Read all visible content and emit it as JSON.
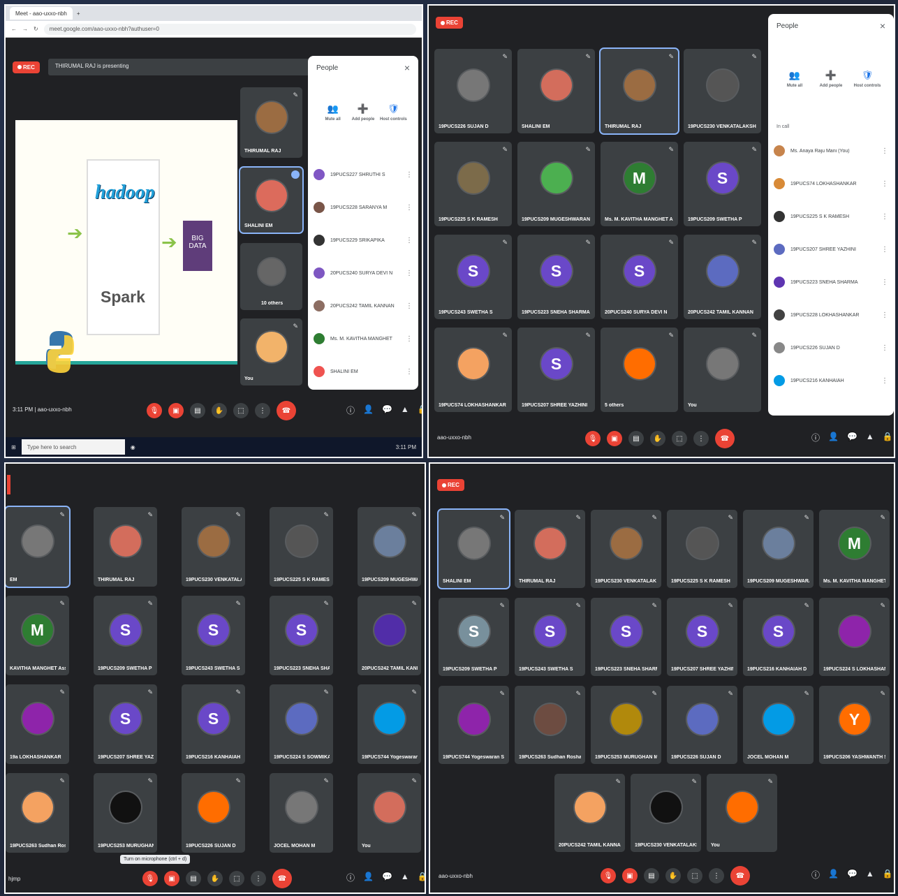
{
  "quad1": {
    "browser": {
      "tab": "Meet - aao-uxxo-nbh",
      "url": "meet.google.com/aao-uxxo-nbh?authuser=0"
    },
    "rec": "REC",
    "presenting": "THIRUMAL RAJ is presenting",
    "slide": {
      "hadoop": "hadoop",
      "spark": "Spark",
      "bigdata_1": "BIG",
      "bigdata_2": "DATA"
    },
    "tiles": [
      {
        "name": "THIRUMAL RAJ",
        "initial": "",
        "color": "#9b6c42"
      },
      {
        "name": "SHALINI EM",
        "initial": "",
        "color": "#dc6b5c"
      },
      {
        "name": "10 others",
        "initial": "",
        "color": "#666"
      },
      {
        "name": "You",
        "initial": "",
        "color": "#f2b36a"
      }
    ],
    "people": {
      "title": "People",
      "actions": [
        {
          "icon": "👥",
          "label": "Mute all"
        },
        {
          "icon": "➕",
          "label": "Add people"
        },
        {
          "icon": "🛡",
          "label": "Host controls"
        }
      ],
      "rows": [
        {
          "name": "19PUCS227 SHRUTHI S",
          "color": "#8057c4"
        },
        {
          "name": "19PUCS228 SARANYA M",
          "color": "#795548"
        },
        {
          "name": "19PUCS229 SRIKAPIKA",
          "color": "#333"
        },
        {
          "name": "20PUCS240 SURYA DEVI N",
          "color": "#7e57c2"
        },
        {
          "name": "20PUCS242 TAMIL KANNAN",
          "color": "#8d6e63"
        },
        {
          "name": "Ms. M. KAVITHA MANGHET",
          "color": "#2e7d32"
        },
        {
          "name": "SHALINI EM",
          "color": "#ef5350"
        }
      ]
    },
    "meeting": {
      "time": "3:11 PM",
      "code": "aao-uxxo-nbh"
    },
    "taskbar": {
      "search": "Type here to search",
      "clock": "3:11 PM"
    }
  },
  "quad2": {
    "rec": "REC",
    "tiles": [
      [
        "19PUCS226 SUJAN D",
        "SHALINI EM",
        "THIRUMAL RAJ",
        "19PUCS230 VENKATALAKSHMI"
      ],
      [
        "19PUCS225 S K RAMESH",
        "19PUCS209 MUGESHWARAN M",
        "Ms. M. KAVITHA MANGHET A",
        "19PUCS209 SWETHA P"
      ],
      [
        "19PUCS243 SWETHA S",
        "19PUCS223 SNEHA SHARMA",
        "20PUCS240 SURYA DEVI N",
        "20PUCS242 TAMIL KANNAN"
      ],
      [
        "19PUCS74 LOKHASHANKAR",
        "19PUCS207 SHREE YAZHINI",
        "5 others",
        "You"
      ]
    ],
    "initials": [
      [
        "",
        "",
        "",
        ""
      ],
      [
        "",
        "",
        "M",
        "S"
      ],
      [
        "S",
        "S",
        "S",
        ""
      ],
      [
        "",
        "S",
        "",
        ""
      ]
    ],
    "people": {
      "title": "People",
      "section": "In call",
      "actions": [
        {
          "icon": "👥",
          "label": "Mute all"
        },
        {
          "icon": "➕",
          "label": "Add people"
        },
        {
          "icon": "🛡",
          "label": "Host controls"
        }
      ],
      "rows": [
        {
          "name": "Ms. Anaya Raju Mani (You)",
          "color": "#c7844c"
        },
        {
          "name": "19PUCS74 LOKHASHANKAR",
          "color": "#d88a37"
        },
        {
          "name": "19PUCS225 S K RAMESH",
          "color": "#333"
        },
        {
          "name": "19PUCS207 SHREE YAZHINI",
          "color": "#5c6bc0"
        },
        {
          "name": "19PUCS223 SNEHA SHARMA",
          "color": "#5e35b1"
        },
        {
          "name": "19PUCS228 LOKHASHANKAR",
          "color": "#424242"
        },
        {
          "name": "19PUCS226 SUJAN D",
          "color": "#888"
        },
        {
          "name": "19PUCS216 KANHAIAH",
          "color": "#039be5"
        }
      ]
    },
    "meeting": {
      "code": "aao-uxxo-nbh"
    }
  },
  "quad3": {
    "meeting": {
      "code": "hjmp",
      "tooltip": "Turn on microphone (ctrl + d)"
    },
    "tiles": [
      [
        "EM",
        "THIRUMAL RAJ",
        "19PUCS230 VENKATALAKSHMI B",
        "19PUCS225 S K RAMESH",
        "19PUCS209 MUGESHWARAN M"
      ],
      [
        "KAVITHA MANGHET Asst Pr",
        "19PUCS209 SWETHA P",
        "19PUCS243 SWETHA S",
        "19PUCS223 SNEHA SHARMA",
        "20PUCS242 TAMIL KANNAN C V"
      ],
      [
        "19a LOKHASHANKAR",
        "19PUCS207 SHREE YAZHINI",
        "19PUCS216 KANHAIAH D",
        "19PUCS224 S SOWMIKARTH",
        "19PUCS744 Yogeswaran S"
      ],
      [
        "19PUCS263 Sudhan Roshan",
        "19PUCS253 MURUGHAN M",
        "19PUCS226 SUJAN D",
        "JOCEL MOHAN M",
        "You"
      ]
    ],
    "initials": [
      [
        "",
        "",
        "",
        "",
        ""
      ],
      [
        "M",
        "S",
        "S",
        "S",
        ""
      ],
      [
        "",
        "S",
        "S",
        "",
        ""
      ],
      [
        "",
        "",
        "",
        "",
        ""
      ]
    ]
  },
  "quad4": {
    "rec": "REC",
    "meeting": {
      "code": "aao-uxxo-nbh"
    },
    "tiles": [
      [
        "SHALINI EM",
        "THIRUMAL RAJ",
        "19PUCS230 VENKATALAK",
        "19PUCS225 S K RAMESH",
        "19PUCS209 MUGESHWARAN M",
        "Ms. M. KAVITHA MANGHET"
      ],
      [
        "19PUCS209 SWETHA P",
        "19PUCS243 SWETHA S",
        "19PUCS223 SNEHA SHARMA",
        "19PUCS207 SHREE YAZHINI",
        "19PUCS216 KANHAIAH D",
        "19PUCS224 S LOKHASHANKAR"
      ],
      [
        "19PUCS744 Yogeswaran S",
        "19PUCS263 Sudhan Roshan",
        "19PUCS253 MURUGHAN M",
        "19PUCS226 SUJAN D",
        "JOCEL MOHAN M",
        "19PUCS206 YASHWANTH S"
      ],
      [
        "20PUCS242 TAMIL KANNAN",
        "19PUCS230 VENKATALAKSHMI",
        "You"
      ]
    ],
    "initials": [
      [
        "",
        "",
        "",
        "",
        "",
        "M"
      ],
      [
        "S",
        "S",
        "S",
        "S",
        "S",
        ""
      ],
      [
        "",
        "",
        "",
        "",
        "",
        "Y"
      ],
      [
        "",
        "",
        ""
      ]
    ]
  },
  "colors": {
    "meet_bg": "#202124",
    "tile": "#3c4043",
    "accent": "#8ab4f8",
    "red": "#ea4335"
  }
}
